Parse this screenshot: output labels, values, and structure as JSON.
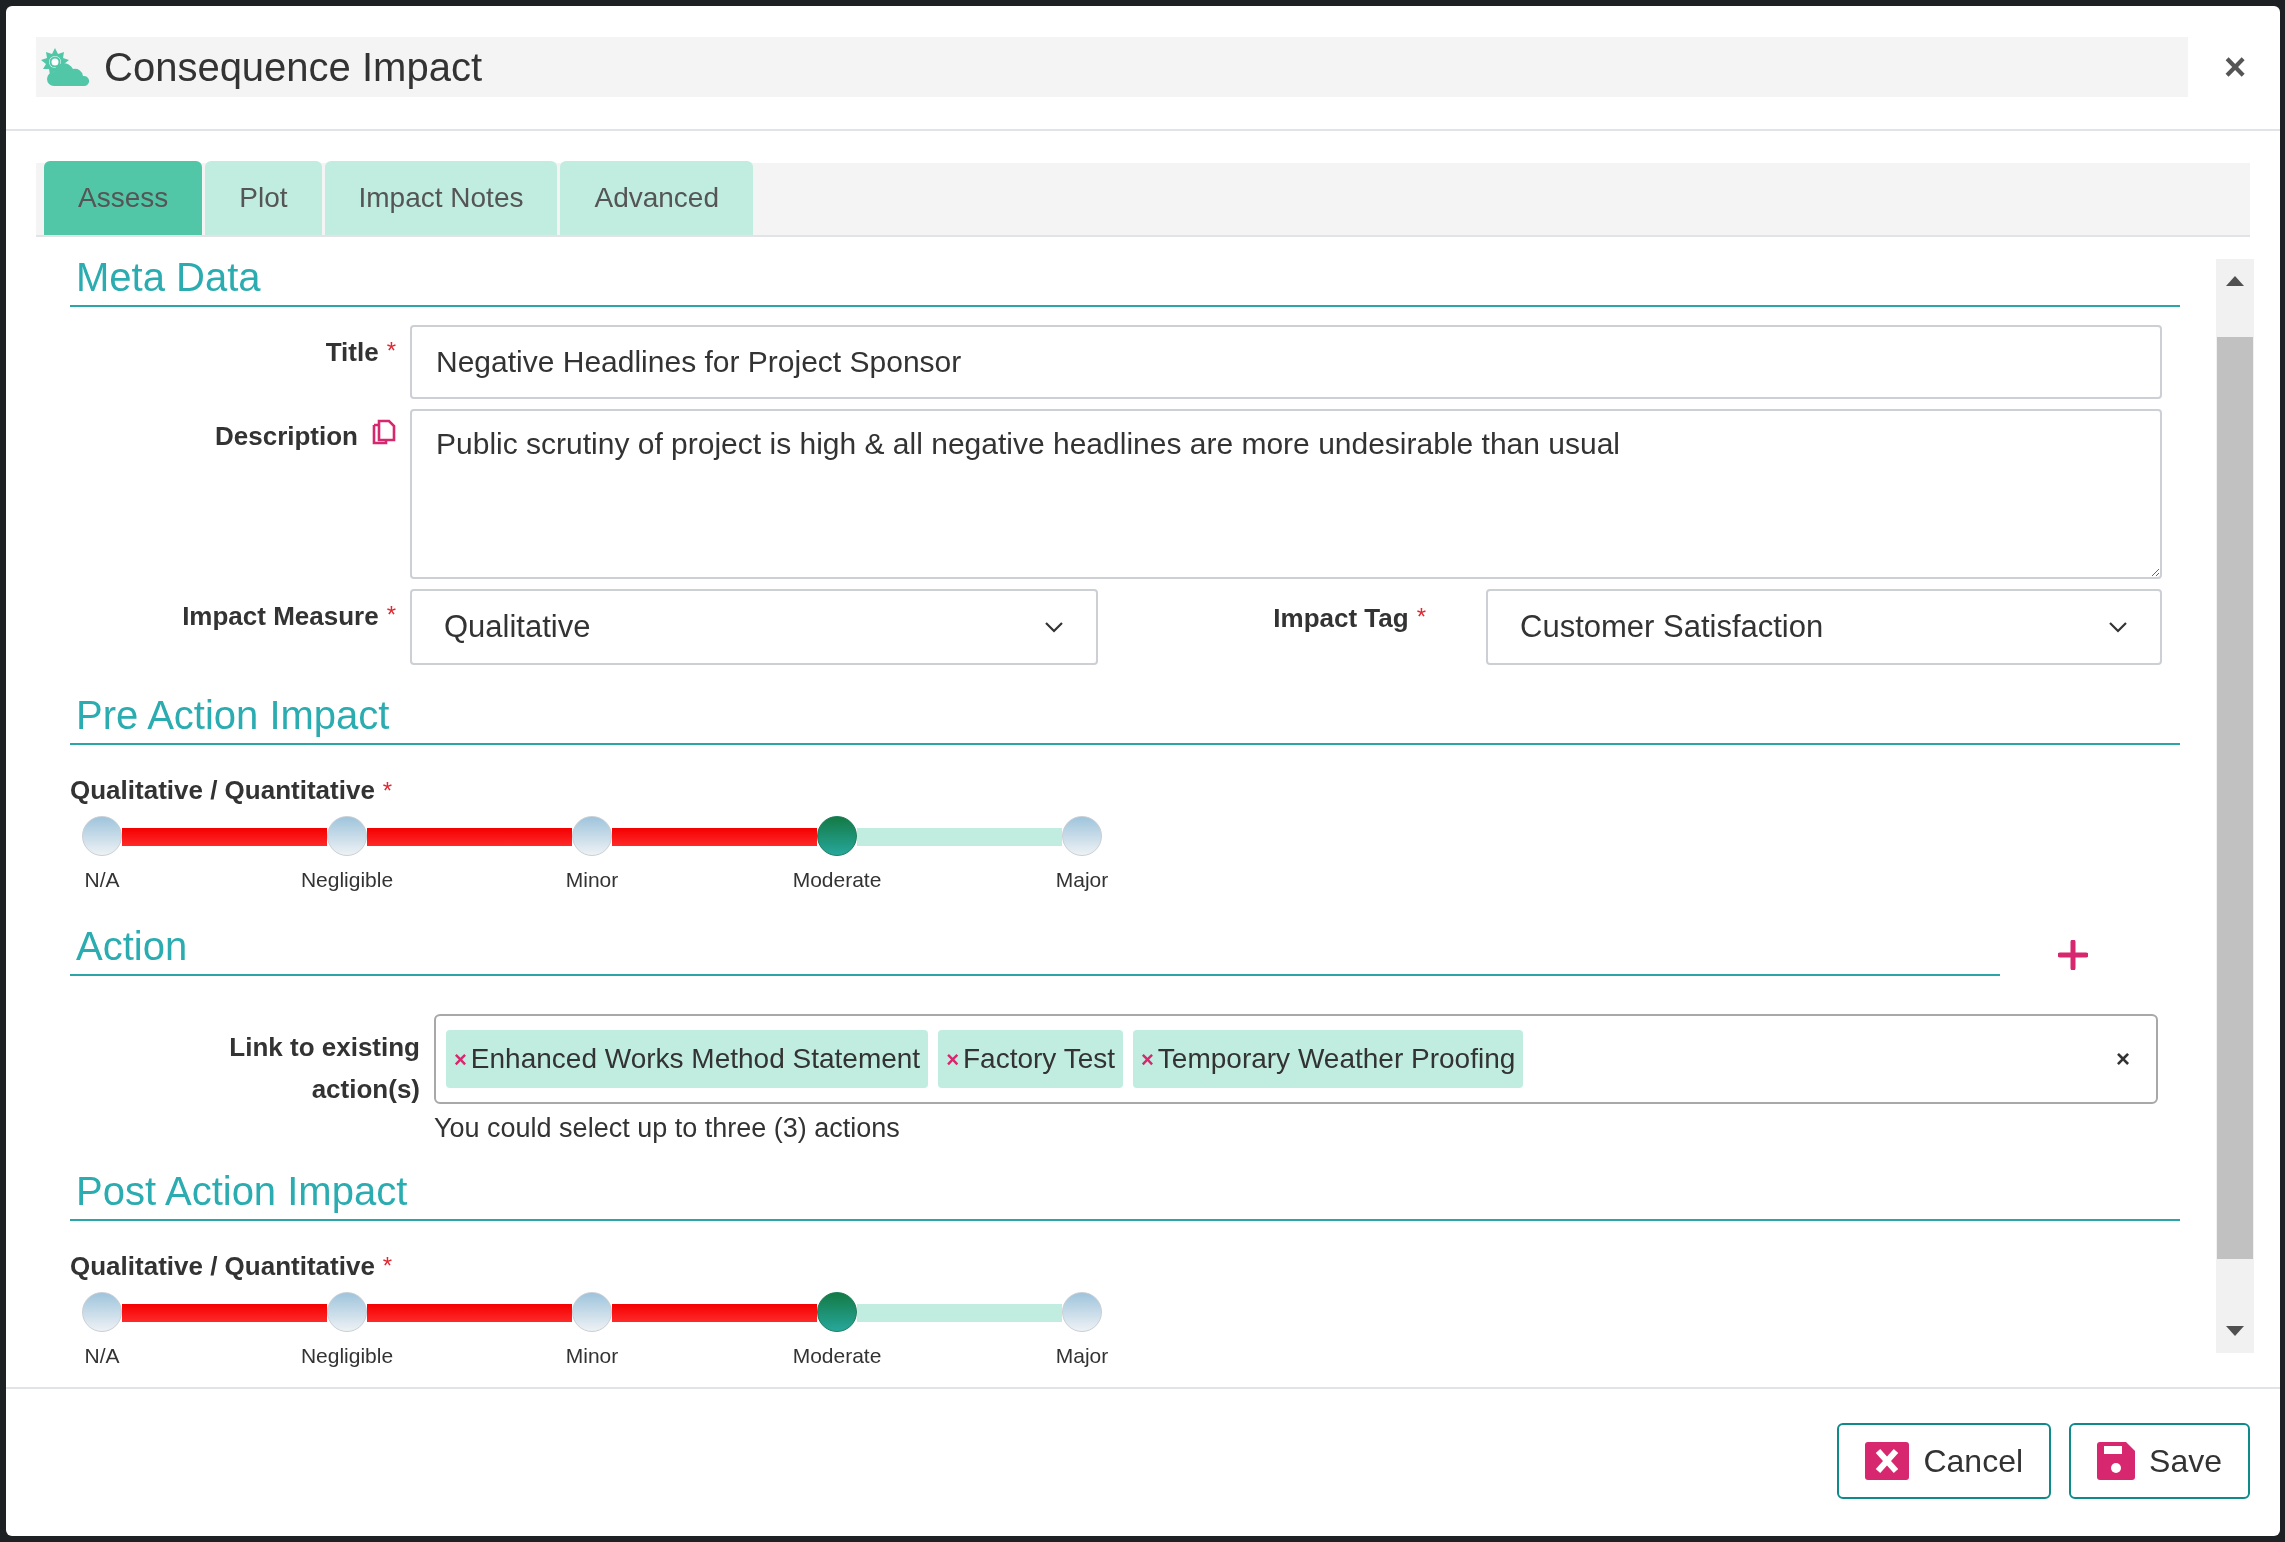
{
  "dialog": {
    "title": "Consequence Impact",
    "close": "×"
  },
  "tabs": [
    {
      "label": "Assess",
      "selected": true
    },
    {
      "label": "Plot",
      "selected": false
    },
    {
      "label": "Impact Notes",
      "selected": false
    },
    {
      "label": "Advanced",
      "selected": false
    }
  ],
  "meta_data": {
    "heading": "Meta Data",
    "title_field": {
      "label": "Title",
      "required": "*",
      "value": "Negative Headlines for Project Sponsor"
    },
    "description_field": {
      "label": "Description",
      "value": "Public scrutiny of project is high & all negative headlines are more undesirable than usual"
    },
    "impact_measure": {
      "label": "Impact Measure",
      "required": "*",
      "value": "Qualitative"
    },
    "impact_tag": {
      "label": "Impact Tag",
      "required": "*",
      "value": "Customer Satisfaction"
    }
  },
  "pre_action_impact": {
    "heading": "Pre Action Impact",
    "label": "Qualitative / Quantitative",
    "required": "*",
    "stops": [
      {
        "label": "N/A",
        "selected": false
      },
      {
        "label": "Negligible",
        "selected": false
      },
      {
        "label": "Minor",
        "selected": false
      },
      {
        "label": "Moderate",
        "selected": true
      },
      {
        "label": "Major",
        "selected": false
      }
    ]
  },
  "action": {
    "heading": "Action",
    "link_label_lines": [
      "Link to existing",
      "action(s)"
    ],
    "tags": [
      {
        "remove": "×",
        "label": "Enhanced Works Method Statement"
      },
      {
        "remove": "×",
        "label": "Factory Test"
      },
      {
        "remove": "×",
        "label": "Temporary Weather Proofing"
      }
    ],
    "clear": "×",
    "hint": "You could select up to three (3) actions"
  },
  "post_action_impact": {
    "heading": "Post Action Impact",
    "label": "Qualitative / Quantitative",
    "required": "*",
    "stops": [
      {
        "label": "N/A",
        "selected": false
      },
      {
        "label": "Negligible",
        "selected": false
      },
      {
        "label": "Minor",
        "selected": false
      },
      {
        "label": "Moderate",
        "selected": true
      },
      {
        "label": "Major",
        "selected": false
      }
    ]
  },
  "buttons": [
    {
      "kind": "cancel",
      "label": "Cancel"
    },
    {
      "kind": "save",
      "label": "Save"
    }
  ]
}
